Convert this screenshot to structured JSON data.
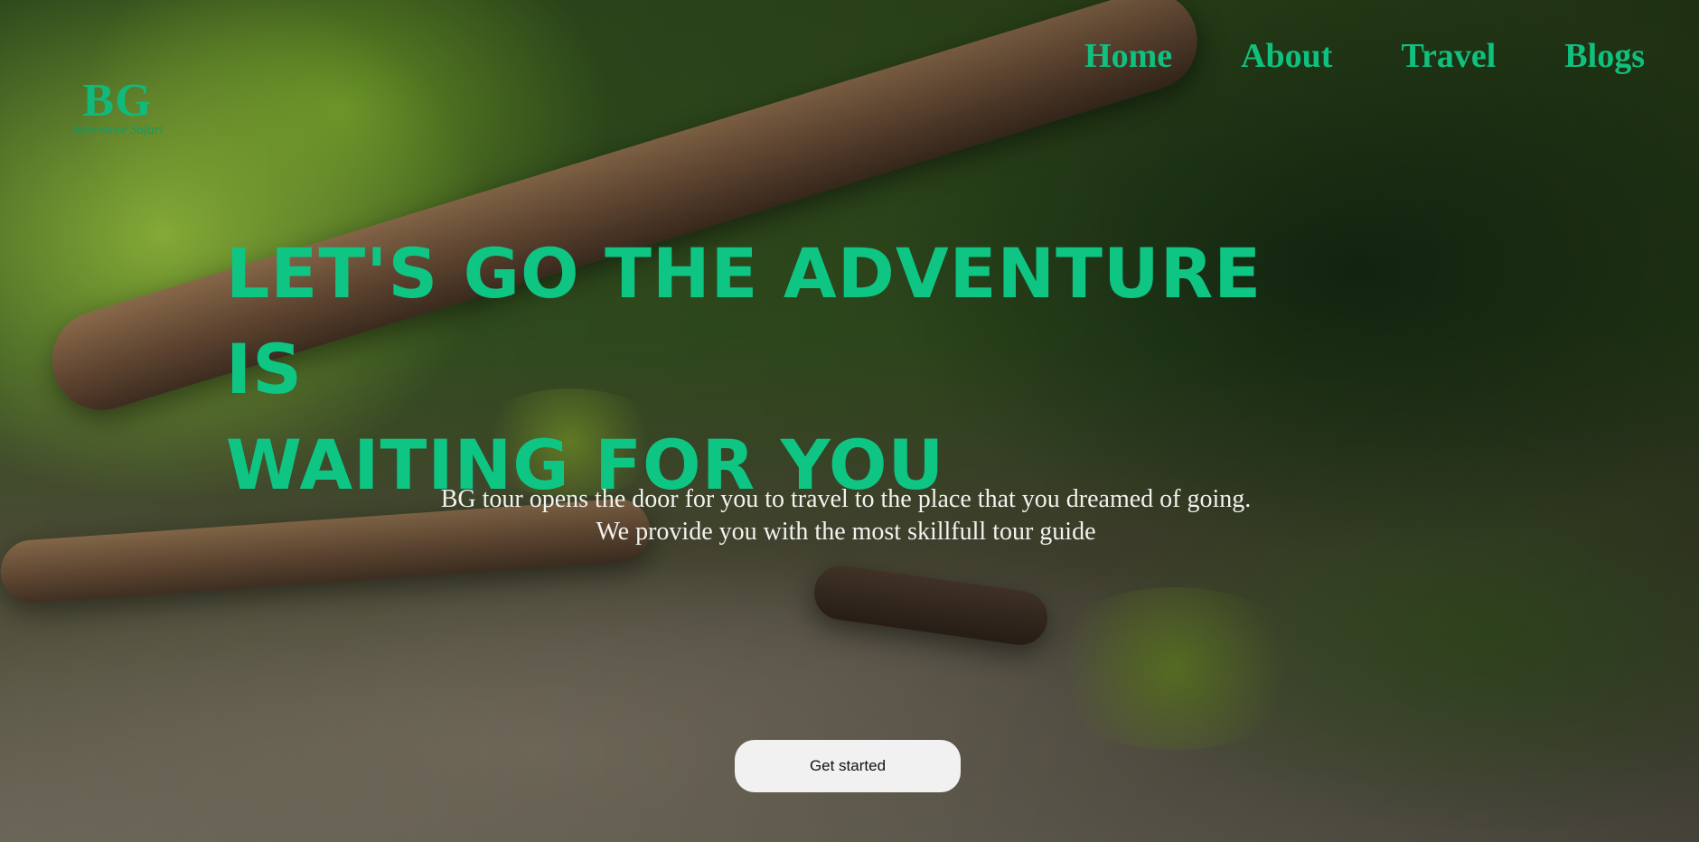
{
  "logo": {
    "mark": "BG",
    "tagline": "Adventure Safari"
  },
  "nav": {
    "items": [
      {
        "label": "Home"
      },
      {
        "label": "About"
      },
      {
        "label": "Travel"
      },
      {
        "label": "Blogs"
      }
    ]
  },
  "hero": {
    "headline_line1": "LET'S GO THE ADVENTURE IS",
    "headline_line2": "WAITING FOR YOU",
    "subtext_line1": "BG tour opens the door for you to travel to the place that you dreamed of going.",
    "subtext_line2": "We provide you with the most skillfull tour guide",
    "cta_label": "Get started"
  },
  "colors": {
    "accent": "#10c07e",
    "cta_background": "#f1f1f1",
    "subtext": "#f2f2ee"
  }
}
